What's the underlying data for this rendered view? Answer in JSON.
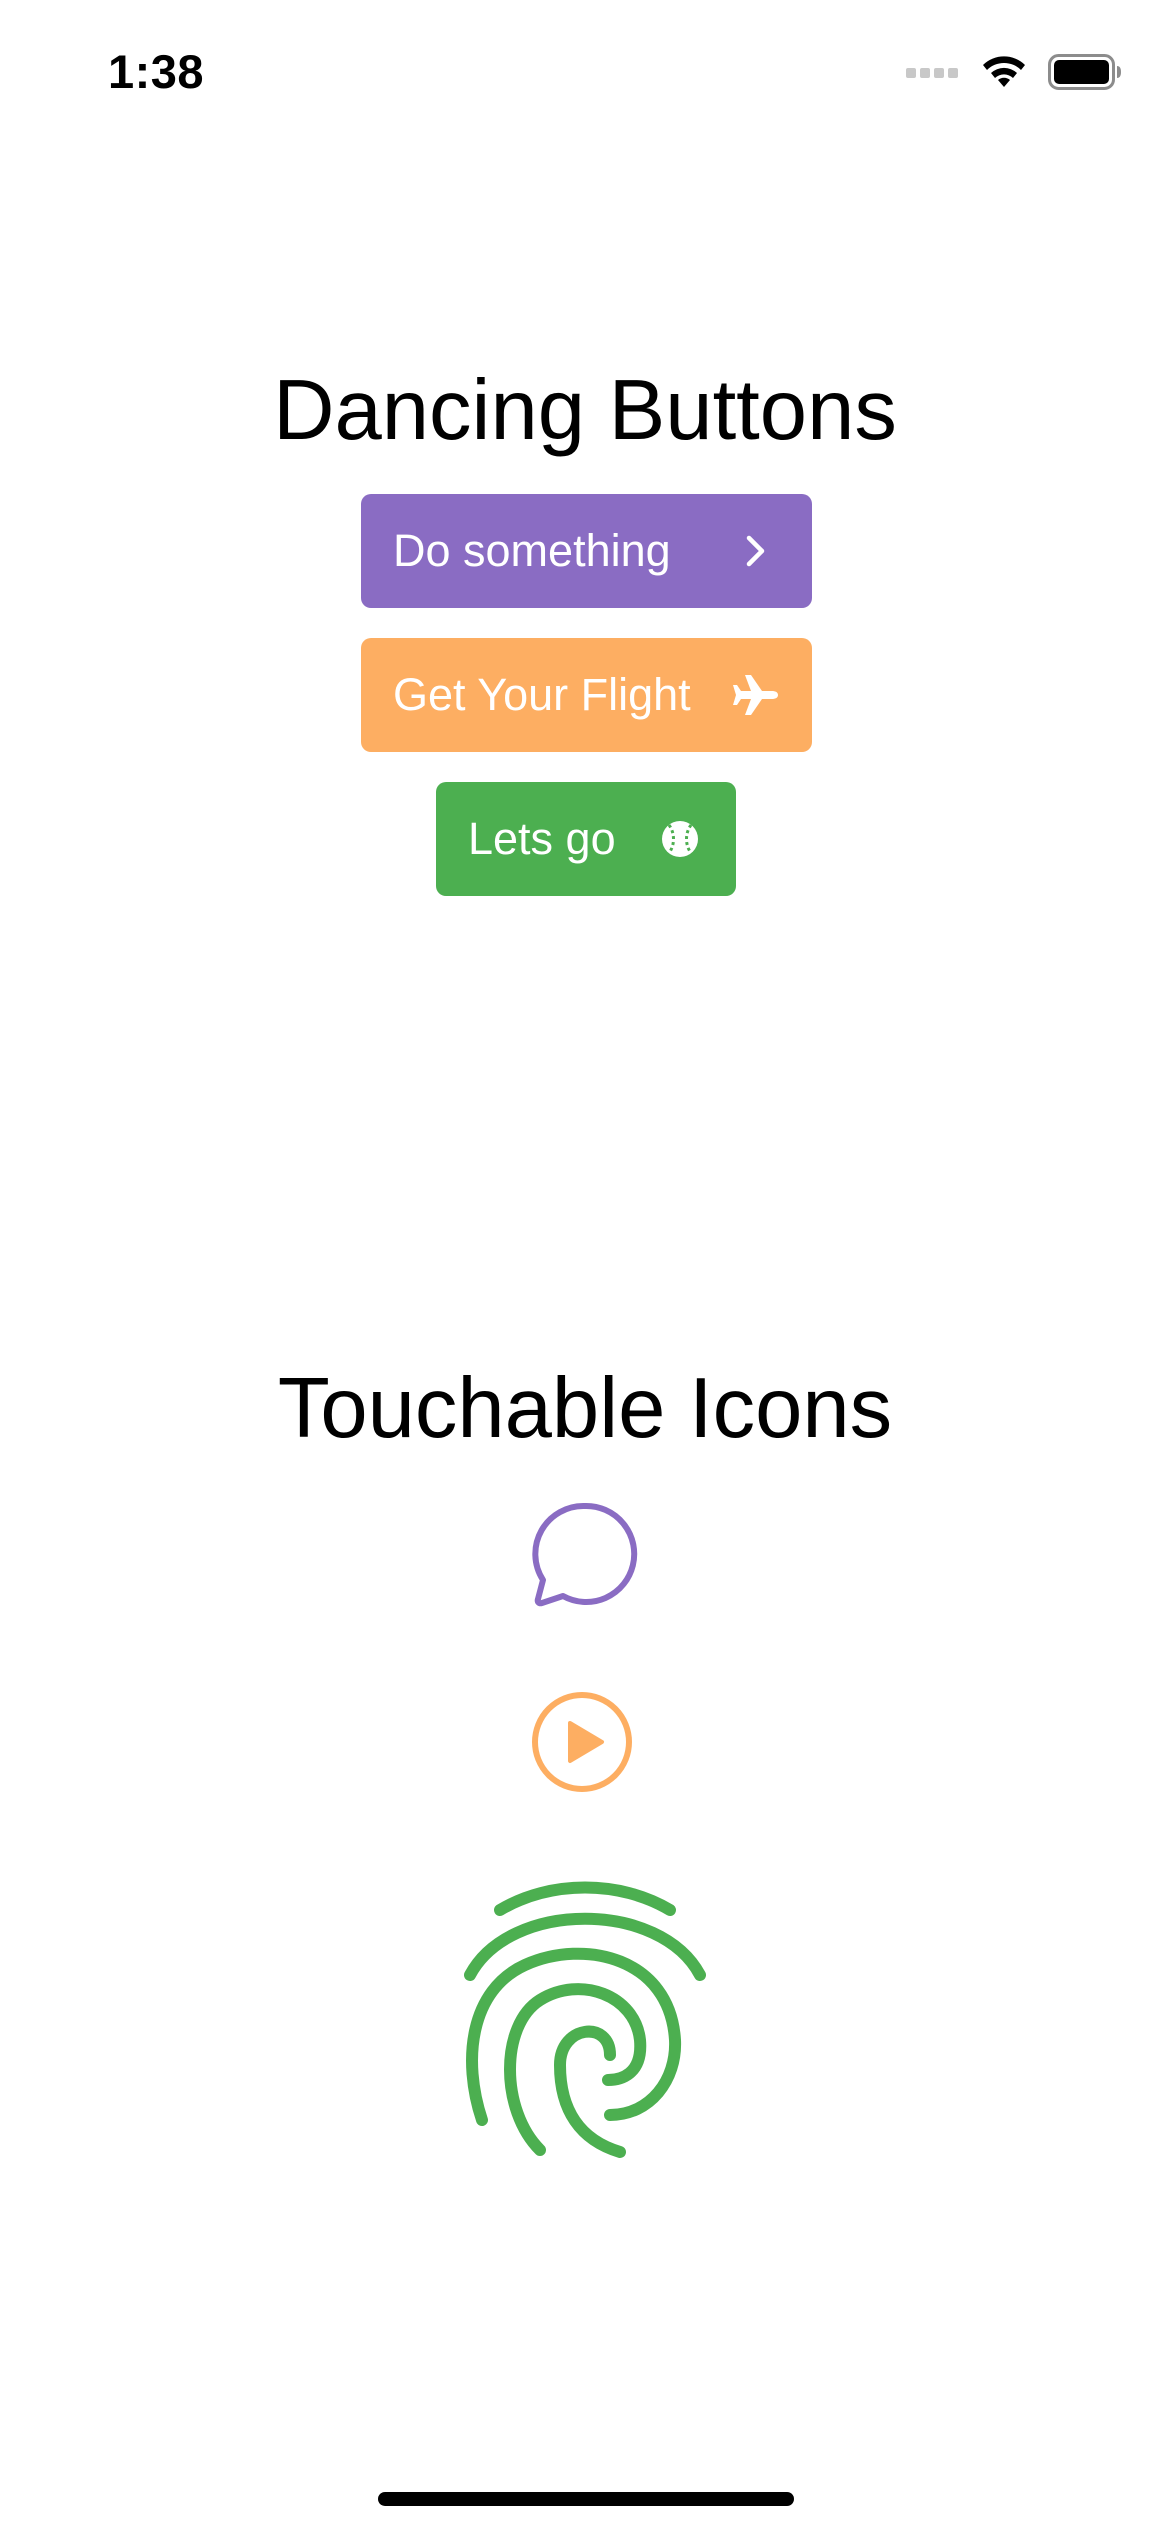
{
  "status_bar": {
    "time": "1:38"
  },
  "sections": {
    "buttons_title": "Dancing Buttons",
    "icons_title": "Touchable Icons"
  },
  "buttons": [
    {
      "label": "Do something",
      "icon": "chevron-right-icon",
      "color": "#8A6CC3"
    },
    {
      "label": "Get Your Flight",
      "icon": "airplane-icon",
      "color": "#FDAE62"
    },
    {
      "label": "Lets go",
      "icon": "baseball-icon",
      "color": "#4CAF50"
    }
  ],
  "touchable_icons": [
    {
      "icon": "chat-bubble-icon",
      "color": "#8A6CC3"
    },
    {
      "icon": "play-circle-icon",
      "color": "#FDAE62"
    },
    {
      "icon": "fingerprint-icon",
      "color": "#4CAF50"
    }
  ]
}
